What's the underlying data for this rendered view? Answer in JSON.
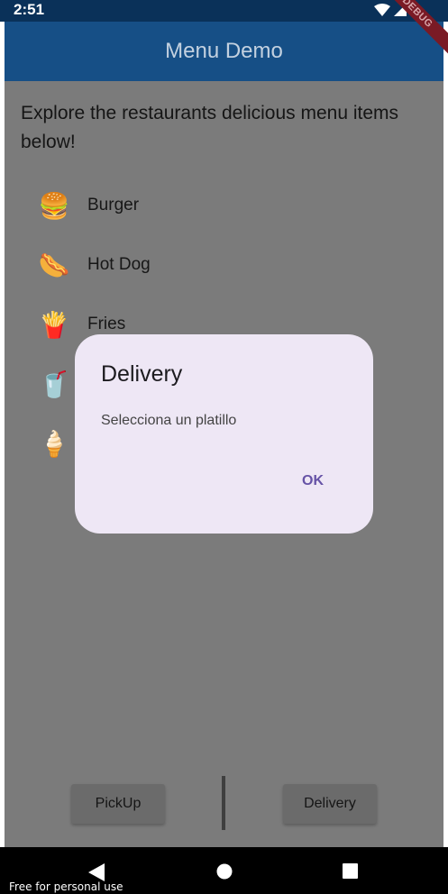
{
  "status_bar": {
    "time": "2:51"
  },
  "app_bar": {
    "title": "Menu Demo",
    "debug_label": "DEBUG"
  },
  "intro_text": "Explore the restaurants delicious menu items below!",
  "menu_items": [
    {
      "label": "Burger",
      "emoji": "🍔"
    },
    {
      "label": "Hot Dog",
      "emoji": "🌭"
    },
    {
      "label": "Fries",
      "emoji": "🍟"
    },
    {
      "label": "",
      "emoji": "🥤"
    },
    {
      "label": "",
      "emoji": "🍦"
    }
  ],
  "bottom_buttons": {
    "pickup": "PickUp",
    "delivery": "Delivery"
  },
  "dialog": {
    "title": "Delivery",
    "message": "Selecciona un platillo",
    "ok": "OK"
  },
  "watermark": "Free for personal use",
  "colors": {
    "app_bar": "#164f86",
    "dialog_bg": "#eee7f5",
    "accent": "#6653a6",
    "scrim": "#7b7b7b"
  }
}
